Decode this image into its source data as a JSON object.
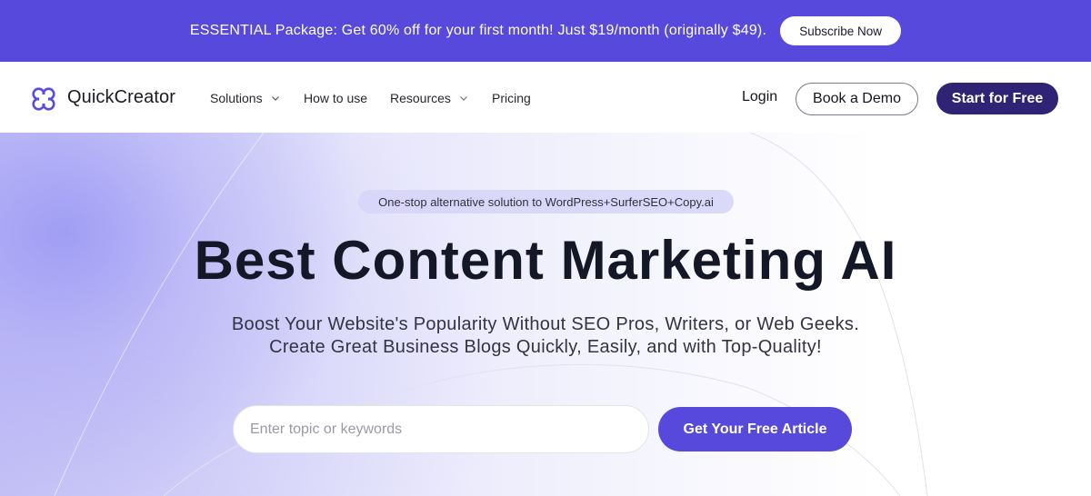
{
  "promo": {
    "text": "ESSENTIAL Package: Get 60% off for your first month! Just $19/month (originally $49).",
    "button_label": "Subscribe Now"
  },
  "nav": {
    "brand": "QuickCreator",
    "logo_icon": "four-petal-logo-icon",
    "items": [
      {
        "label": "Solutions",
        "has_dropdown": true
      },
      {
        "label": "How to use",
        "has_dropdown": false
      },
      {
        "label": "Resources",
        "has_dropdown": true
      },
      {
        "label": "Pricing",
        "has_dropdown": false
      }
    ],
    "login_label": "Login",
    "demo_label": "Book a Demo",
    "start_label": "Start for Free"
  },
  "hero": {
    "tagline": "One-stop alternative solution to WordPress+SurferSEO+Copy.ai",
    "headline": "Best Content Marketing AI",
    "subline_1": "Boost Your Website's Popularity Without SEO Pros, Writers, or Web Geeks.",
    "subline_2": "Create Great Business Blogs Quickly, Easily, and with Top-Quality!",
    "input_placeholder": "Enter topic or keywords",
    "input_value": "",
    "cta_label": "Get Your Free Article"
  },
  "colors": {
    "brand_purple": "#5849dd",
    "dark_purple": "#2f2375",
    "headline_text": "#141826"
  }
}
